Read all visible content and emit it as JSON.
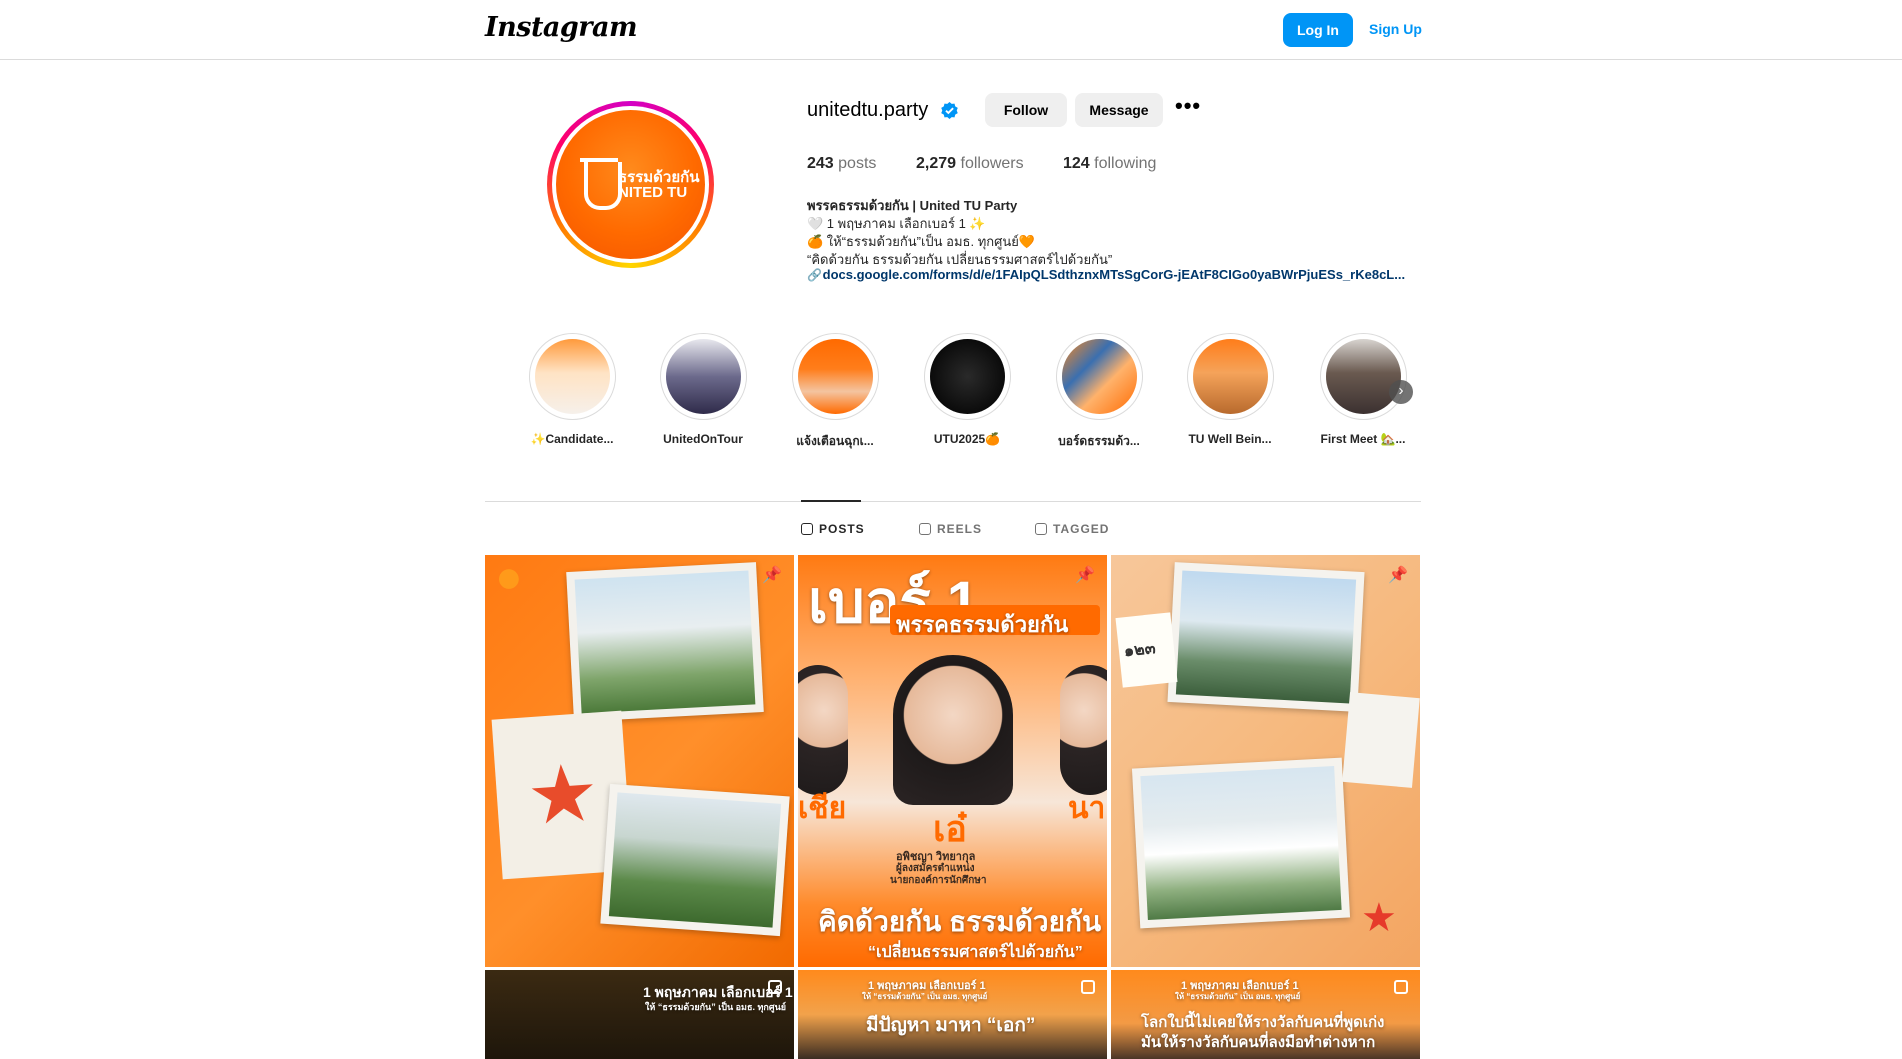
{
  "nav": {
    "logo": "Instagram",
    "login_label": "Log In",
    "signup_label": "Sign Up"
  },
  "profile": {
    "username": "unitedtu.party",
    "verified_icon": "verified-badge-icon",
    "follow_label": "Follow",
    "message_label": "Message",
    "more_icon": "more-options-icon",
    "avatar_text_line1": "ธรรมด้วยกัน",
    "avatar_text_line2": "NITED TU",
    "stats": {
      "posts_count": "243",
      "posts_label": "posts",
      "followers_count": "2,279",
      "followers_label": "followers",
      "following_count": "124",
      "following_label": "following"
    },
    "bio": {
      "name": "พรรคธรรมด้วยกัน | United TU Party",
      "line1": "🤍 1 พฤษภาคม เลือกเบอร์ 1 ✨",
      "line2": "🍊 ให้“ธรรมด้วยกัน”เป็น อมธ. ทุกศูนย์🧡",
      "line3": "“คิดด้วยกัน ธรรมด้วยกัน เปลี่ยนธรรมศาสตร์ไปด้วยกัน”",
      "link": "docs.google.com/forms/d/e/1FAIpQLSdthznxMTsSgCorG-jEAtF8CIGo0yaBWrPjuESs_rKe8cL..."
    }
  },
  "highlights": [
    {
      "label": "✨Candidate..."
    },
    {
      "label": "UnitedOnTour"
    },
    {
      "label": "แจ้งเตือนฉุกเ..."
    },
    {
      "label": "UTU2025🍊"
    },
    {
      "label": "บอร์ดธรรมด้ว..."
    },
    {
      "label": "TU Well Bein..."
    },
    {
      "label": "First Meet 🏡..."
    }
  ],
  "tabs": {
    "posts": "POSTS",
    "reels": "REELS",
    "tagged": "TAGGED"
  },
  "posts": [
    {
      "pinned": true
    },
    {
      "pinned": true,
      "heading": "เบอร์ 1",
      "subheading": "พรรคธรรมด้วยกัน",
      "name_center": "เอ๋",
      "name_left": "เชีย",
      "name_right": "นา",
      "caption": "คิดด้วยกัน ธรรมด้วยกัน",
      "candidate": "อพิชญา วิทยากุล",
      "position": "ผู้ลงสมัครตำแหน่ง",
      "position2": "นายกองค์การนักศึกษา",
      "caption2": "“เปลี่ยนธรรมศาสตร์ไปด้วยกัน”"
    },
    {
      "pinned": true,
      "note": "๑๒๓"
    },
    {
      "multi": false,
      "text1": "1 พฤษภาคม เลือกเบอร์ 1",
      "text2": "ให้ “ธรรมด้วยกัน” เป็น อมธ. ทุกศูนย์"
    },
    {
      "multi": true,
      "text1": "1 พฤษภาคม เลือกเบอร์ 1",
      "text2": "ให้ “ธรรมด้วยกัน” เป็น อมธ. ทุกศูนย์",
      "text3": "มีปัญหา มาหา “เอก”"
    },
    {
      "multi": true,
      "text1": "1 พฤษภาคม เลือกเบอร์ 1",
      "text2": "ให้ “ธรรมด้วยกัน” เป็น อมธ. ทุกศูนย์",
      "text3": "โลกใบนี้ไม่เคยให้รางวัลกับคนที่พูดเก่ง",
      "text4": "มันให้รางวัลกับคนที่ลงมือทำต่างหาก"
    }
  ],
  "colors": {
    "accent": "#0095f6",
    "brand_orange": "#ff6a00",
    "link": "#00376b"
  }
}
